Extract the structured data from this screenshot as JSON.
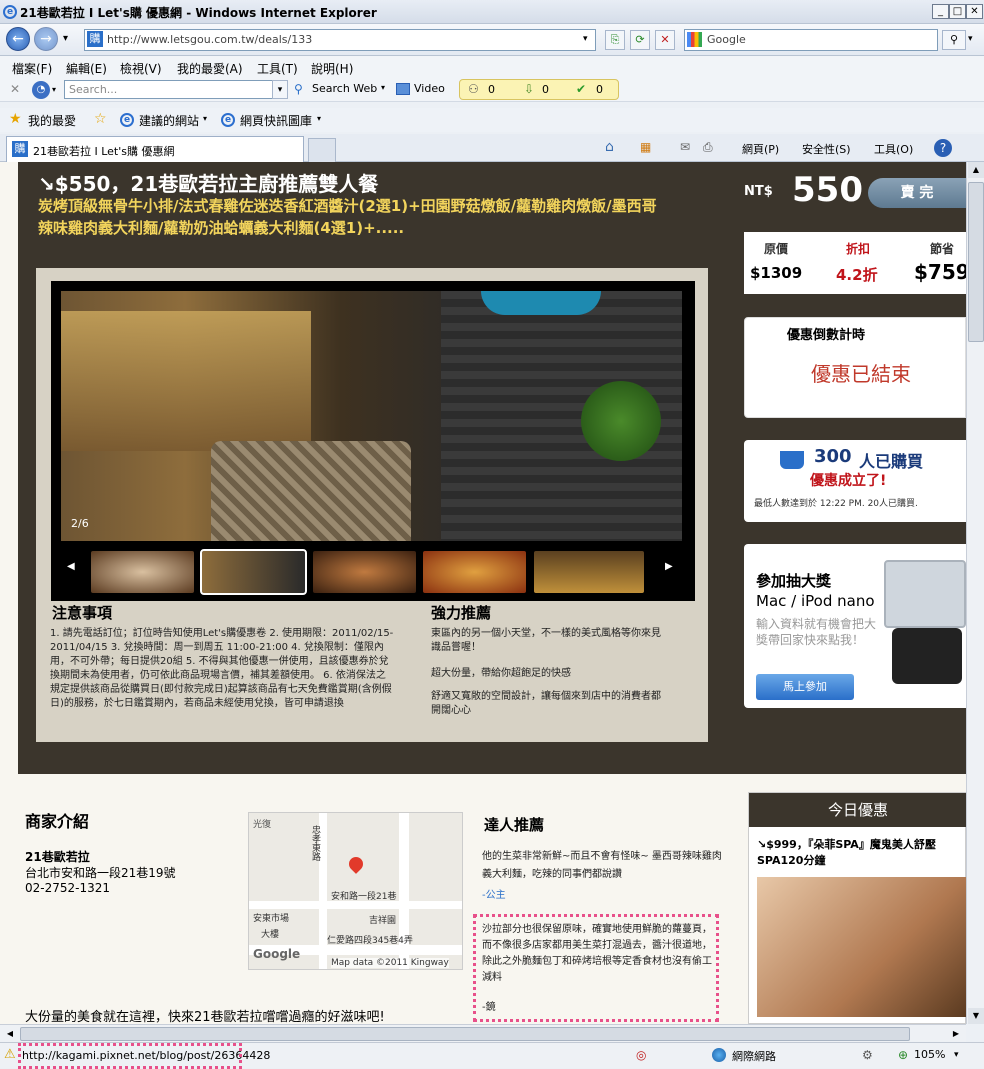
{
  "window": {
    "title": "21巷歐若拉 I Let's購 優惠網 - Windows Internet Explorer"
  },
  "nav": {
    "url": "http://www.letsgou.com.tw/deals/133",
    "search_placeholder": "Google"
  },
  "menu": [
    "檔案(F)",
    "編輯(E)",
    "檢視(V)",
    "我的最愛(A)",
    "工具(T)",
    "說明(H)"
  ],
  "toolbar2": {
    "search_placeholder": "Search...",
    "search_web": "Search Web",
    "video": "Video",
    "counts": [
      "0",
      "0",
      "0"
    ]
  },
  "favbar": {
    "favorites": "我的最愛",
    "suggested": "建議的網站",
    "webslice": "網頁快訊圖庫"
  },
  "tab": {
    "label": "21巷歐若拉 I Let's購 優惠網"
  },
  "cmdbar": [
    "網頁(P)",
    "安全性(S)",
    "工具(O)"
  ],
  "deal": {
    "title": "↘$550，21巷歐若拉主廚推薦雙人餐",
    "subtitle": "炭烤頂級無骨牛小排/法式春雞佐迷迭香紅酒醬汁(2選1)+田園野菇燉飯/蘿勒雞肉燉飯/墨西哥辣味雞肉義大利麵/蘿勒奶油蛤蠣義大利麵(4選1)+.....",
    "currency": "NT$",
    "price": "550",
    "sold_label": "賣 完",
    "orig_label": "原價",
    "orig": "$1309",
    "disc_label": "折扣",
    "disc": "4.2折",
    "save_label": "節省",
    "save": "$759",
    "photo_counter": "2/6",
    "notes_title": "注意事項",
    "notes": "1. 請先電話訂位；訂位時告知使用Let's購優惠卷 2. 使用期限：2011/02/15-2011/04/15 3. 兌換時間：周一到周五 11:00-21:00 4. 兌換限制：僅限內用，不可外帶；每日提供20組 5. 不得與其他優惠一併使用，且該優惠券於兌換期間未為使用者，仍可依此商品現場言價，補其差額使用。 6. 依消保法之規定提供該商品從購買日(即付款完成日)起算該商品有七天免費鑑賞期(含例假日)的服務，於七日鑑賞期內，若商品未經使用兌換，皆可申請退換",
    "rec_title": "強力推薦",
    "rec": [
      "東區內的另一個小天堂，不一樣的美式風格等你來見識品嘗喔！",
      "超大份量，帶給你超飽足的快感",
      "舒適又寬敞的空間設計，讓每個來到店中的消費者都開闊心心"
    ]
  },
  "countdown": {
    "title": "優惠倒數計時",
    "status": "優惠已結束"
  },
  "buyers": {
    "count": "300",
    "label": "人已購買",
    "success": "優惠成立了!",
    "note": "最低人數達到於 12:22 PM. 20人已購買."
  },
  "promo": {
    "title": "參加抽大獎",
    "product": "Mac / iPod nano",
    "desc": "輸入資料就有機會把大獎帶回家快來點我！",
    "button": "馬上參加"
  },
  "merchant": {
    "section": "商家介紹",
    "name": "21巷歐若拉",
    "address": "台北市安和路一段21巷19號",
    "phone": "02-2752-1321",
    "tagline": "大份量的美食就在這裡，快來21巷歐若拉嚐嚐過癮的好滋味吧!"
  },
  "map": {
    "labels": [
      "光復",
      "安和路一段21巷",
      "吉祥園",
      "仁愛路四段345巷4弄",
      "忠孝東路",
      "安東市場",
      "大樓",
      "Map data ©2011 Kingway",
      "Google"
    ]
  },
  "expert": {
    "section": "達人推薦",
    "review1": "他的生菜非常新鮮~而且不會有怪味~ 墨西哥辣味雞肉義大利麵，吃辣的同事們都說讚",
    "author1": "-公主",
    "review2": "沙拉部分也很保留原味，確實地使用鮮脆的蘿蔓頁，而不像很多店家都用美生菜打混過去，醬汁很道地，除此之外脆麵包丁和碎烤培根等定香食材也沒有偷工減料",
    "author2": "-鏡"
  },
  "today": {
    "title": "今日優惠",
    "deal": "↘$999，『朵菲SPA』魔鬼美人舒壓SPA120分鐘"
  },
  "status": {
    "url": "http://kagami.pixnet.net/blog/post/26364428",
    "zone": "網際網路",
    "zoom": "105%"
  },
  "colors": {
    "accent": "#f2d45c",
    "hero_bg": "#3b352c",
    "discount": "#c0141a"
  }
}
